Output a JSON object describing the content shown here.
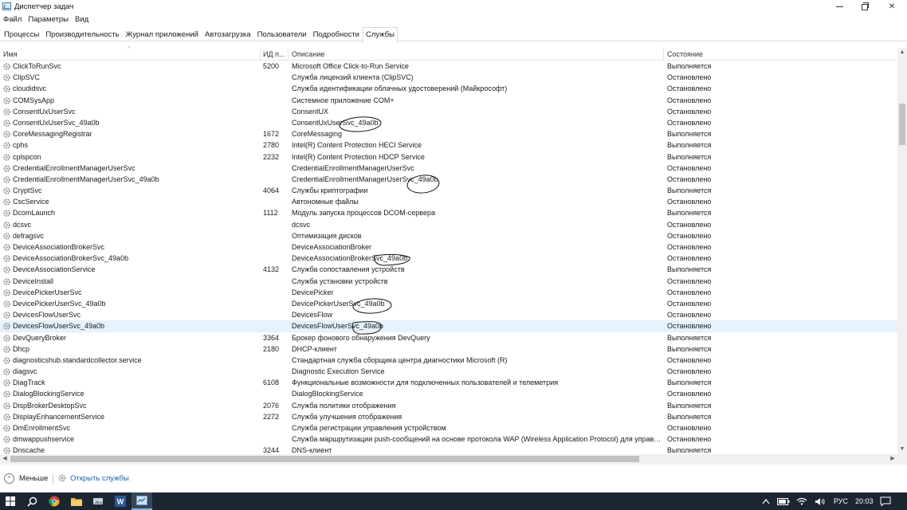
{
  "window": {
    "title": "Диспетчер задач",
    "min_label": "—",
    "max_label": "",
    "close_label": "✕"
  },
  "menu": [
    "Файл",
    "Параметры",
    "Вид"
  ],
  "tabs": [
    {
      "label": "Процессы",
      "active": false
    },
    {
      "label": "Производительность",
      "active": false
    },
    {
      "label": "Журнал приложений",
      "active": false
    },
    {
      "label": "Автозагрузка",
      "active": false
    },
    {
      "label": "Пользователи",
      "active": false
    },
    {
      "label": "Подробности",
      "active": false
    },
    {
      "label": "Службы",
      "active": true
    }
  ],
  "columns": {
    "name": "Имя",
    "pid": "ИД п...",
    "description": "Описание",
    "state": "Состояние"
  },
  "services": [
    {
      "name": "ClickToRunSvc",
      "pid": "5200",
      "description": "Microsoft Office Click-to-Run Service",
      "state": "Выполняется"
    },
    {
      "name": "ClipSVC",
      "pid": "",
      "description": "Служба лицензий клиента (ClipSVC)",
      "state": "Остановлено"
    },
    {
      "name": "cloudidsvc",
      "pid": "",
      "description": "Служба идентификации облачных удостоверений (Майкрософт)",
      "state": "Остановлено"
    },
    {
      "name": "COMSysApp",
      "pid": "",
      "description": "Системное приложение COM+",
      "state": "Остановлено"
    },
    {
      "name": "ConsentUxUserSvc",
      "pid": "",
      "description": "ConsentUX",
      "state": "Остановлено"
    },
    {
      "name": "ConsentUxUserSvc_49a0b",
      "pid": "",
      "description": "ConsentUxUserSvc_49a0b",
      "state": "Остановлено"
    },
    {
      "name": "CoreMessagingRegistrar",
      "pid": "1672",
      "description": "CoreMessaging",
      "state": "Выполняется"
    },
    {
      "name": "cphs",
      "pid": "2780",
      "description": "Intel(R) Content Protection HECI Service",
      "state": "Выполняется"
    },
    {
      "name": "cplspcon",
      "pid": "2232",
      "description": "Intel(R) Content Protection HDCP Service",
      "state": "Выполняется"
    },
    {
      "name": "CredentialEnrollmentManagerUserSvc",
      "pid": "",
      "description": "CredentialEnrollmentManagerUserSvc",
      "state": "Остановлено"
    },
    {
      "name": "CredentialEnrollmentManagerUserSvc_49a0b",
      "pid": "",
      "description": "CredentialEnrollmentManagerUserSvc_49a0b",
      "state": "Остановлено"
    },
    {
      "name": "CryptSvc",
      "pid": "4064",
      "description": "Службы криптографии",
      "state": "Выполняется"
    },
    {
      "name": "CscService",
      "pid": "",
      "description": "Автономные файлы",
      "state": "Остановлено"
    },
    {
      "name": "DcomLaunch",
      "pid": "1112",
      "description": "Модуль запуска процессов DCOM-сервера",
      "state": "Выполняется"
    },
    {
      "name": "dcsvc",
      "pid": "",
      "description": "dcsvc",
      "state": "Остановлено"
    },
    {
      "name": "defragsvc",
      "pid": "",
      "description": "Оптимизация дисков",
      "state": "Остановлено"
    },
    {
      "name": "DeviceAssociationBrokerSvc",
      "pid": "",
      "description": "DeviceAssociationBroker",
      "state": "Остановлено"
    },
    {
      "name": "DeviceAssociationBrokerSvc_49a0b",
      "pid": "",
      "description": "DeviceAssociationBrokerSvc_49a0b",
      "state": "Остановлено"
    },
    {
      "name": "DeviceAssociationService",
      "pid": "4132",
      "description": "Служба сопоставления устройств",
      "state": "Выполняется"
    },
    {
      "name": "DeviceInstall",
      "pid": "",
      "description": "Служба установки устройств",
      "state": "Остановлено"
    },
    {
      "name": "DevicePickerUserSvc",
      "pid": "",
      "description": "DevicePicker",
      "state": "Остановлено"
    },
    {
      "name": "DevicePickerUserSvc_49a0b",
      "pid": "",
      "description": "DevicePickerUserSvc_49a0b",
      "state": "Остановлено"
    },
    {
      "name": "DevicesFlowUserSvc",
      "pid": "",
      "description": "DevicesFlow",
      "state": "Остановлено"
    },
    {
      "name": "DevicesFlowUserSvc_49a0b",
      "pid": "",
      "description": "DevicesFlowUserSvc_49a0b",
      "state": "Остановлено",
      "selected": true
    },
    {
      "name": "DevQueryBroker",
      "pid": "3364",
      "description": "Брокер фонового обнаружения DevQuery",
      "state": "Выполняется"
    },
    {
      "name": "Dhcp",
      "pid": "2180",
      "description": "DHCP-клиент",
      "state": "Выполняется"
    },
    {
      "name": "diagnosticshub.standardcollector.service",
      "pid": "",
      "description": "Стандартная служба сборщика центра диагностики Microsoft (R)",
      "state": "Остановлено"
    },
    {
      "name": "diagsvc",
      "pid": "",
      "description": "Diagnostic Execution Service",
      "state": "Остановлено"
    },
    {
      "name": "DiagTrack",
      "pid": "6108",
      "description": "Функциональные возможности для подключенных пользователей и телеметрия",
      "state": "Выполняется"
    },
    {
      "name": "DialogBlockingService",
      "pid": "",
      "description": "DialogBlockingService",
      "state": "Остановлено"
    },
    {
      "name": "DispBrokerDesktopSvc",
      "pid": "2076",
      "description": "Служба политики отображения",
      "state": "Выполняется"
    },
    {
      "name": "DisplayEnhancementService",
      "pid": "2272",
      "description": "Служба улучшения отображения",
      "state": "Выполняется"
    },
    {
      "name": "DmEnrollmentSvc",
      "pid": "",
      "description": "Служба регистрации управления устройством",
      "state": "Остановлено"
    },
    {
      "name": "dmwappushservice",
      "pid": "",
      "description": "Служба маршрутизации push-сообщений на основе протокола WAP (Wireless Application Protocol) для управл...",
      "state": "Остановлено"
    },
    {
      "name": "Dnscache",
      "pid": "3244",
      "description": "DNS-клиент",
      "state": "Выполняется"
    }
  ],
  "footer": {
    "less_label": "Меньше",
    "open_services_label": "Открыть службы"
  },
  "taskbar": {
    "language": "РУС",
    "time": "20:03"
  }
}
